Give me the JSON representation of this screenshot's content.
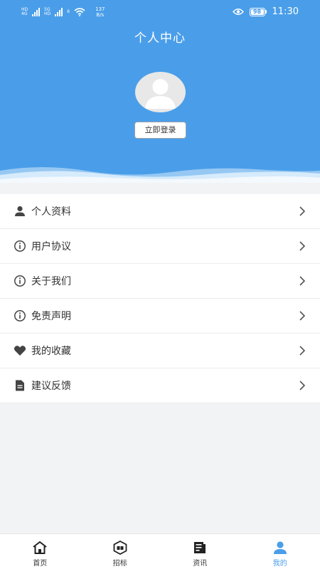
{
  "status_bar": {
    "network_left": [
      "HD",
      "4G"
    ],
    "network_right": [
      "5G",
      "HD"
    ],
    "wifi_badge": "6",
    "speed_value": "137",
    "speed_unit": "B/s",
    "battery": "98",
    "time": "11:30",
    "icons": [
      "signal-icon",
      "wifi-icon",
      "eye-icon",
      "battery-icon"
    ]
  },
  "header": {
    "title": "个人中心",
    "login_button": "立即登录",
    "background_color": "#4a9ee9"
  },
  "menu": {
    "items": [
      {
        "label": "个人资料",
        "icon": "person-icon"
      },
      {
        "label": "用户协议",
        "icon": "info-icon"
      },
      {
        "label": "关于我们",
        "icon": "info-icon"
      },
      {
        "label": "免责声明",
        "icon": "info-icon"
      },
      {
        "label": "我的收藏",
        "icon": "heart-icon"
      },
      {
        "label": "建议反馈",
        "icon": "document-icon"
      }
    ]
  },
  "tabbar": {
    "tabs": [
      {
        "label": "首页",
        "icon": "home-icon",
        "active": false
      },
      {
        "label": "招标",
        "icon": "bid-icon",
        "active": false
      },
      {
        "label": "资讯",
        "icon": "news-icon",
        "active": false
      },
      {
        "label": "我的",
        "icon": "profile-icon",
        "active": true
      }
    ],
    "active_color": "#4a9ee9"
  }
}
